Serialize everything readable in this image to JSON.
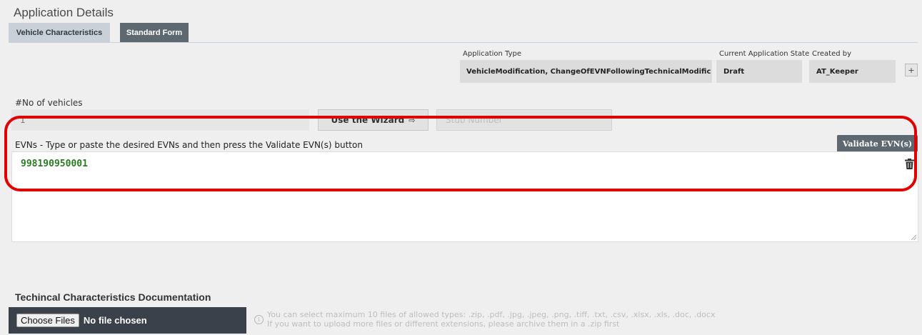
{
  "page": {
    "title": "Application Details"
  },
  "tabs": [
    {
      "label": "Vehicle Characteristics"
    },
    {
      "label": "Standard Form"
    }
  ],
  "meta": {
    "application_type": {
      "label": "Application Type",
      "value": "VehicleModification, ChangeOfEVNFollowingTechnicalModific"
    },
    "current_state": {
      "label": "Current Application State",
      "value": "Draft"
    },
    "created_by": {
      "label": "Created by",
      "value": "AT_Keeper"
    },
    "plus_label": "+"
  },
  "vehicles": {
    "label": "#No of vehicles",
    "value": "1",
    "wizard_label": "Use the Wizard",
    "wizard_icon": "arrow-right-icon",
    "stub_placeholder": "Stub Number"
  },
  "evn": {
    "label": "EVNs - Type or paste the desired EVNs and then press the Validate EVN(s) button",
    "validate_label": "Validate EVN(s)",
    "entries": [
      "998190950001"
    ],
    "delete_icon": "trash-icon"
  },
  "docs": {
    "title": "Techincal Characteristics Documentation",
    "choose_label": "Choose Files",
    "status": "No file chosen",
    "info_line1": "You can select maximum 10 files of allowed types: .zip, .pdf, .jpg, .jpeg, .png, .tiff, .txt, .csv, .xlsx, .xls, .doc, .docx",
    "info_line2": "If you want to upload more files or different extensions, please archive them in a .zip first"
  },
  "colors": {
    "highlight": "#e00000",
    "evn_text": "#2a7a23",
    "dark_button": "#5d6870",
    "file_bar": "#3b414a"
  }
}
